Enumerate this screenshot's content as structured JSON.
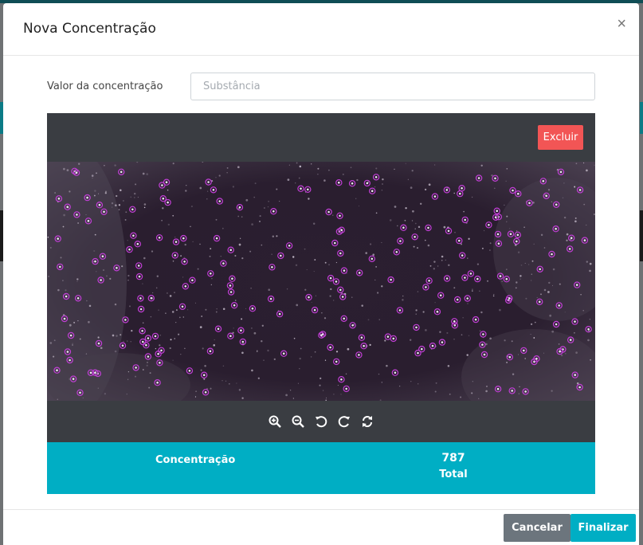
{
  "modal": {
    "title": "Nova Concentração",
    "close_icon": "×"
  },
  "form": {
    "label": "Valor da concentração",
    "input_value": "",
    "input_placeholder": "Substância"
  },
  "viewer": {
    "delete_label": "Excluir",
    "image_description": "microscope-particle-image",
    "tools": [
      "zoom-in-icon",
      "zoom-out-icon",
      "rotate-left-icon",
      "rotate-right-icon",
      "reset-icon"
    ]
  },
  "summary": {
    "label": "Concentração",
    "value": "787",
    "total_label": "Total"
  },
  "footer": {
    "cancel_label": "Cancelar",
    "finish_label": "Finalizar"
  },
  "colors": {
    "accent": "#00aec4",
    "danger": "#f25555",
    "secondary": "#6c757d",
    "viewer_bg": "#3a3d42",
    "marker": "#c23fd6"
  }
}
